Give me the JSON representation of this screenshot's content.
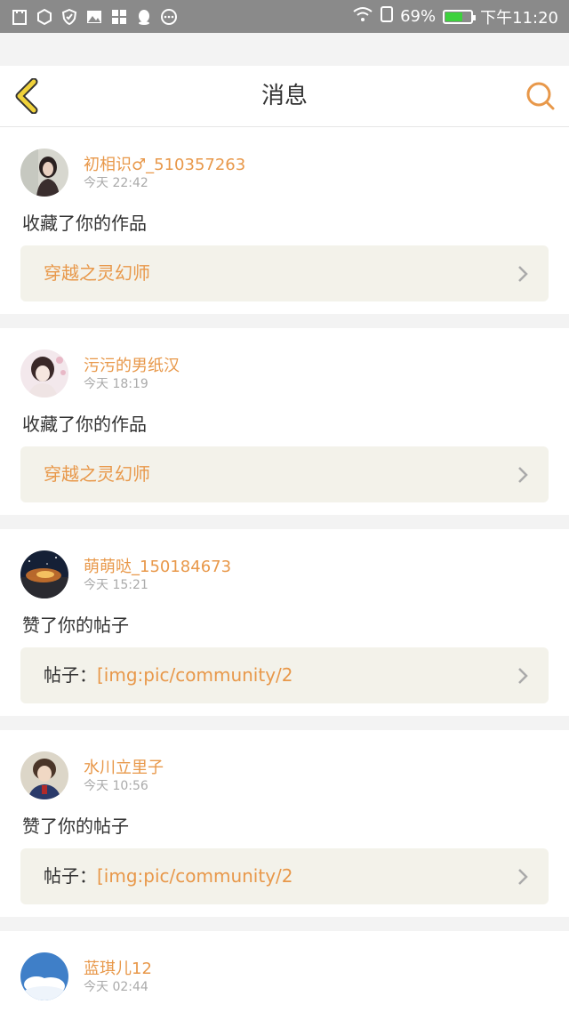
{
  "status_bar": {
    "battery_percent": "69%",
    "battery_level": 0.69,
    "time": "下午11:20",
    "icons": [
      "clipboard-icon",
      "shield-box-icon",
      "shield-icon",
      "image-icon",
      "grid-icon",
      "qq-icon",
      "more-icon",
      "wifi-icon",
      "sim-icon",
      "battery-icon"
    ]
  },
  "header": {
    "title": "消息",
    "back_icon": "chevron-left-icon",
    "search_icon": "search-icon"
  },
  "colors": {
    "accent": "#e8984a",
    "back_arrow": "#f0d23a",
    "link_bg": "#f3f2ea",
    "battery": "#3dd13d"
  },
  "messages": [
    {
      "user": "初相识♂_510357263",
      "time": "今天 22:42",
      "action": "收藏了你的作品",
      "link_prefix": "",
      "link_text": "穿越之灵幻师"
    },
    {
      "user": "污污的男纸汉",
      "time": "今天 18:19",
      "action": "收藏了你的作品",
      "link_prefix": "",
      "link_text": "穿越之灵幻师"
    },
    {
      "user": "萌萌哒_150184673",
      "time": "今天 15:21",
      "action": "赞了你的帖子",
      "link_prefix": "帖子：",
      "link_text": "[img:pic/community/2"
    },
    {
      "user": "水川立里子",
      "time": "今天 10:56",
      "action": "赞了你的帖子",
      "link_prefix": "帖子：",
      "link_text": "[img:pic/community/2"
    },
    {
      "user": "蓝琪儿12",
      "time": "今天 02:44"
    }
  ]
}
